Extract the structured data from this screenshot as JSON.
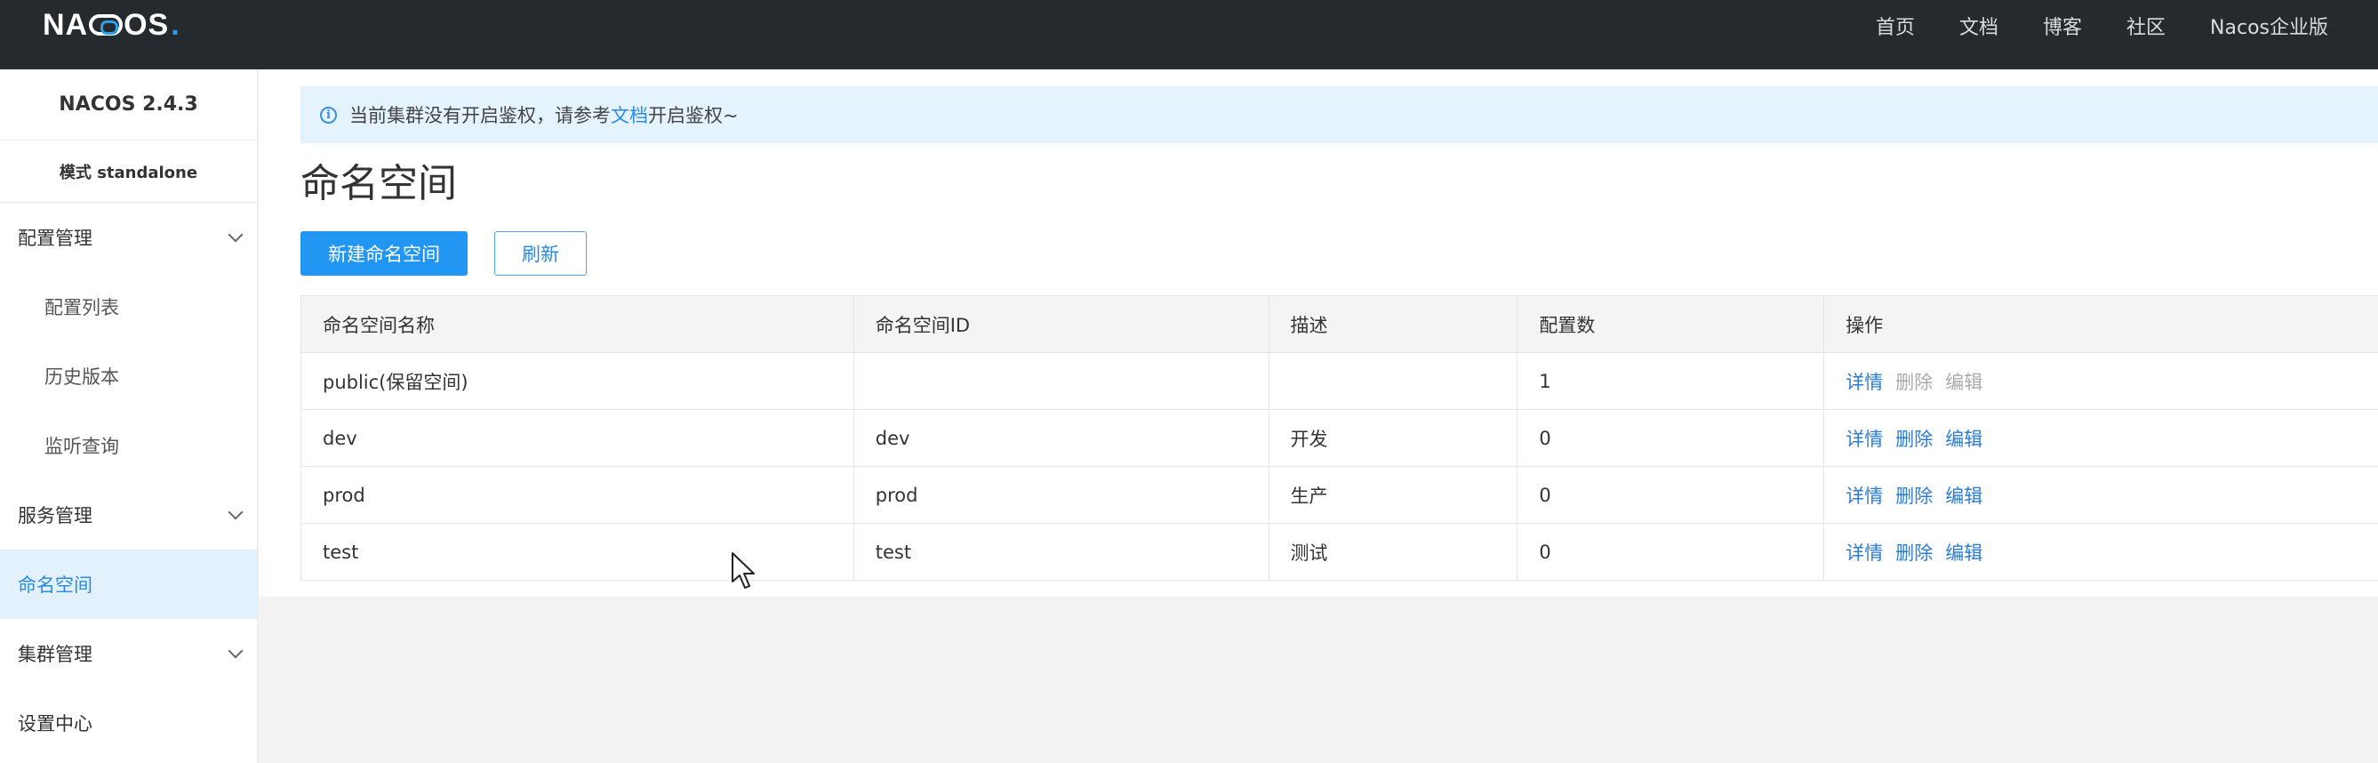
{
  "topbar": {
    "logo_text_1": "NA",
    "logo_text_2": "OS",
    "logo_dot": ".",
    "nav": [
      "首页",
      "文档",
      "博客",
      "社区",
      "Nacos企业版"
    ]
  },
  "sidebar": {
    "version": "NACOS 2.4.3",
    "mode": "模式 standalone",
    "items": [
      {
        "label": "配置管理"
      },
      {
        "label": "配置列表"
      },
      {
        "label": "历史版本"
      },
      {
        "label": "监听查询"
      },
      {
        "label": "服务管理"
      },
      {
        "label": "命名空间"
      },
      {
        "label": "集群管理"
      },
      {
        "label": "设置中心"
      }
    ]
  },
  "notice": {
    "text_before": "当前集群没有开启鉴权，请参考",
    "link": "文档",
    "text_after": "开启鉴权~"
  },
  "page": {
    "title": "命名空间",
    "create_button": "新建命名空间",
    "refresh_button": "刷新"
  },
  "table": {
    "headers": [
      "命名空间名称",
      "命名空间ID",
      "描述",
      "配置数",
      "操作"
    ],
    "rows": [
      {
        "name": "public(保留空间)",
        "id": "",
        "desc": "",
        "count": "1"
      },
      {
        "name": "dev",
        "id": "dev",
        "desc": "开发",
        "count": "0"
      },
      {
        "name": "prod",
        "id": "prod",
        "desc": "生产",
        "count": "0"
      },
      {
        "name": "test",
        "id": "test",
        "desc": "测试",
        "count": "0"
      }
    ],
    "actions": {
      "detail": "详情",
      "delete": "删除",
      "edit": "编辑"
    }
  },
  "colors": {
    "topbar": "#252a2f",
    "accent": "#2196f3",
    "link": "#2a7cd6",
    "active_menu_bg": "#e3f1fc",
    "notice_bg": "#e4f3fd"
  }
}
